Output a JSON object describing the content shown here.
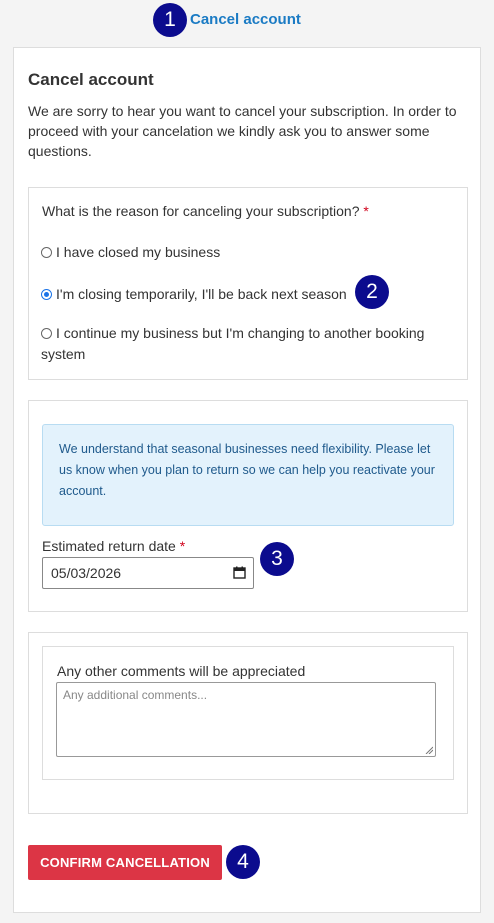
{
  "header": {
    "step1": "1",
    "link": "Cancel account"
  },
  "card": {
    "title": "Cancel account",
    "intro": "We are sorry to hear you want to cancel your subscription. In order to proceed with your cancelation we kindly ask you to answer some questions."
  },
  "reason": {
    "question": "What is the reason for canceling your subscription?",
    "required_mark": "*",
    "options": [
      {
        "label": "I have closed my business",
        "checked": false
      },
      {
        "label": "I'm closing temporarily, I'll be back next season",
        "checked": true
      },
      {
        "label": "I continue my business but I'm changing to another booking system",
        "checked": false
      }
    ],
    "step": "2"
  },
  "seasonal": {
    "info": "We understand that seasonal businesses need flexibility. Please let us know when you plan to return so we can help you reactivate your account.",
    "date_label": "Estimated return date",
    "required_mark": "*",
    "date_value": "05/03/2026",
    "step": "3"
  },
  "comments": {
    "label": "Any other comments will be appreciated",
    "placeholder": "Any additional comments..."
  },
  "confirm": {
    "label": "CONFIRM CANCELLATION",
    "step": "4"
  },
  "colors": {
    "badge": "#0b0b8e",
    "link": "#1b7bc4",
    "danger": "#dc3545",
    "info_bg": "#e3f2fc",
    "info_text": "#1f5a8c"
  }
}
